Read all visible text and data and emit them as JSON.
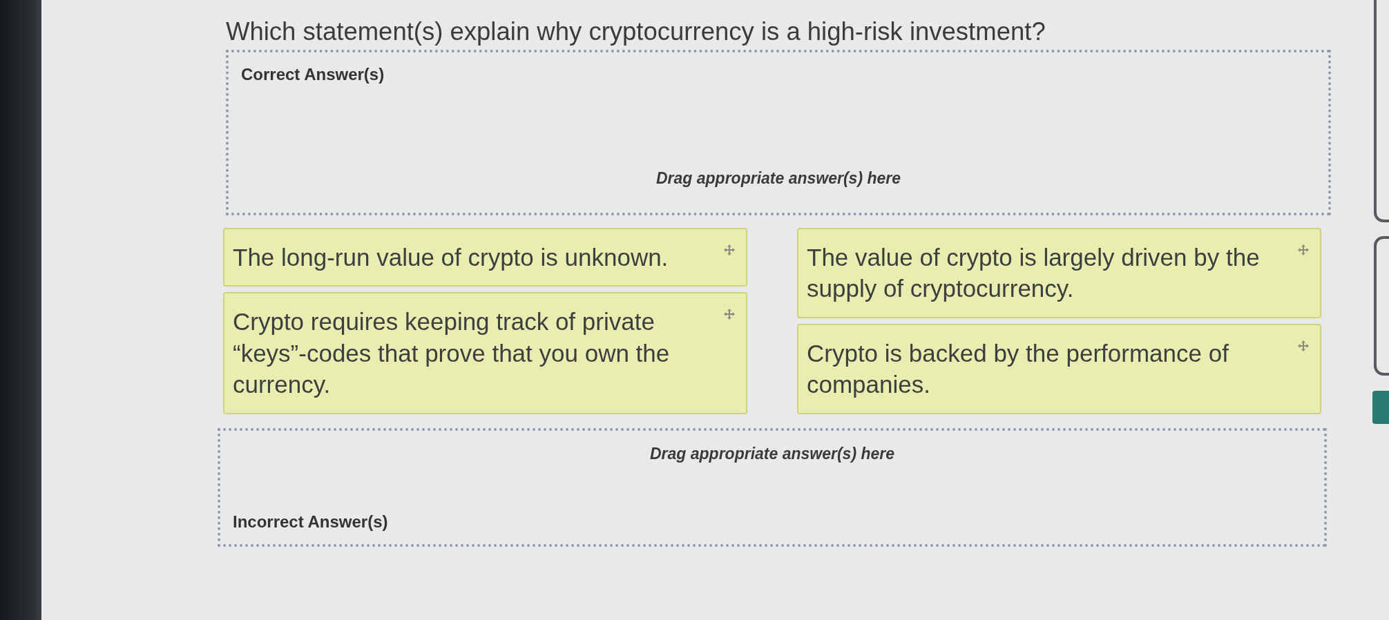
{
  "question": "Which statement(s) explain why cryptocurrency is a high-risk investment?",
  "correct_zone": {
    "kind": "correct",
    "title": "Correct Answer(s)",
    "hint": "Drag appropriate answer(s) here"
  },
  "answer_columns": [
    {
      "answers": [
        {
          "text": "The long-run value of crypto is unknown."
        },
        {
          "text": "Crypto requires keeping track of private “keys”-codes that prove that you own the currency."
        }
      ]
    },
    {
      "answers": [
        {
          "text": "The value of crypto is largely driven by the supply of cryptocurrency."
        },
        {
          "text": "Crypto is backed by the performance of companies."
        }
      ]
    }
  ],
  "incorrect_zone": {
    "kind": "incorrect",
    "title": "Incorrect Answer(s)",
    "hint": "Drag appropriate answer(s) here"
  }
}
